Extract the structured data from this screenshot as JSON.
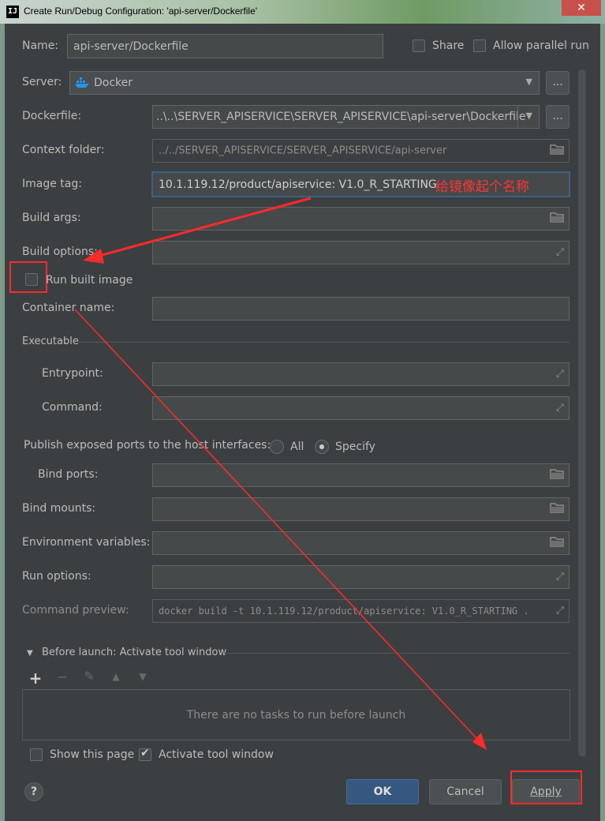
{
  "window": {
    "title": "Create Run/Debug Configuration: 'api-server/Dockerfile'",
    "app_icon": "IJ",
    "close_glyph": "✕"
  },
  "top": {
    "name_label": "Name:",
    "name_value": "api-server/Dockerfile",
    "share_label": "Share",
    "allow_parallel_label": "Allow parallel run"
  },
  "server": {
    "label": "Server:",
    "value": "Docker",
    "more": "..."
  },
  "dockerfile": {
    "label": "Dockerfile:",
    "value": "..\\..\\SERVER_APISERVICE\\SERVER_APISERVICE\\api-server\\Dockerfile",
    "more": "..."
  },
  "context": {
    "label": "Context folder:",
    "value": "../../SERVER_APISERVICE/SERVER_APISERVICE/api-server"
  },
  "image_tag": {
    "label": "Image tag:",
    "value": "10.1.119.12/product/apiservice: V1.0_R_STARTING",
    "annotation": "给镜像起个名称"
  },
  "build_args": {
    "label": "Build args:"
  },
  "build_options": {
    "label": "Build options:"
  },
  "run_built": {
    "label": "Run built image",
    "checked": false
  },
  "container_name": {
    "label": "Container name:"
  },
  "executable": {
    "header": "Executable",
    "entrypoint_label": "Entrypoint:",
    "command_label": "Command:"
  },
  "publish": {
    "label": "Publish exposed ports to the host interfaces:",
    "all_label": "All",
    "specify_label": "Specify",
    "selected": "Specify"
  },
  "bind_ports": {
    "label": "Bind ports:"
  },
  "bind_mounts": {
    "label": "Bind mounts:"
  },
  "env_vars": {
    "label": "Environment variables:"
  },
  "run_options": {
    "label": "Run options:"
  },
  "command_preview": {
    "label": "Command preview:",
    "value": "docker build -t 10.1.119.12/product/apiservice: V1.0_R_STARTING  ."
  },
  "before_launch": {
    "header": "Before launch: Activate tool window",
    "empty_text": "There are no tasks to run before launch",
    "add": "+",
    "remove": "−",
    "edit": "✎",
    "up": "▲",
    "down": "▼"
  },
  "bottom": {
    "show_page_label": "Show this page",
    "activate_label": "Activate tool window",
    "show_page_checked": false,
    "activate_checked": true
  },
  "buttons": {
    "help": "?",
    "ok": "OK",
    "cancel": "Cancel",
    "apply": "Apply"
  },
  "colors": {
    "annotation_red": "#ff3333",
    "ok_blue": "#365880",
    "accent_focus": "#3d6185",
    "docker_blue": "#2496ed"
  }
}
